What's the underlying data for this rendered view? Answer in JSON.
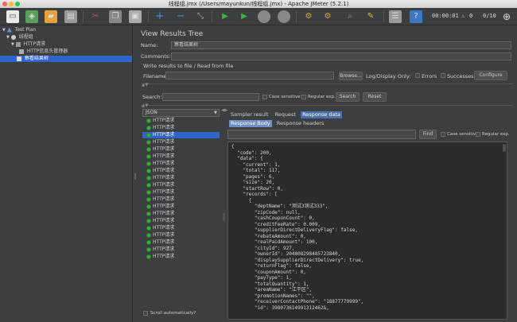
{
  "window": {
    "title": "线程组.jmx (/Users/mayunkun/线程组.jmx) - Apache JMeter (5.2.1)"
  },
  "toolbar": {
    "elapsed_time": "00:00:01",
    "warning_count": "0",
    "thread_counter": "0/10"
  },
  "tree": {
    "items": [
      {
        "label": "Test Plan"
      },
      {
        "label": "线程组"
      },
      {
        "label": "HTTP请求"
      },
      {
        "label": "HTTP信息头管理器"
      },
      {
        "label": "察看结果树"
      }
    ]
  },
  "panel": {
    "title": "View Results Tree",
    "name_label": "Name:",
    "name_value": "察看结果树",
    "comments_label": "Comments:",
    "comments_value": "",
    "write_results_label": "Write results to file / Read from file",
    "filename_label": "Filename",
    "filename_value": "",
    "browse_label": "Browse...",
    "log_display_label": "Log/Display Only:",
    "errors_label": "Errors",
    "successes_label": "Successes",
    "configure_label": "Configure",
    "search_label": "Search:",
    "search_value": "",
    "case_sensitive_label": "Case sensitive",
    "regular_exp_label": "Regular exp.",
    "search_button": "Search",
    "reset_button": "Reset",
    "renderer_value": "JSON",
    "scroll_auto_label": "Scroll automatically?"
  },
  "results": {
    "items": [
      {
        "label": "HTTP请求"
      },
      {
        "label": "HTTP请求"
      },
      {
        "label": "HTTP请求"
      },
      {
        "label": "HTTP请求"
      },
      {
        "label": "HTTP请求"
      },
      {
        "label": "HTTP请求"
      },
      {
        "label": "HTTP请求"
      },
      {
        "label": "HTTP请求"
      },
      {
        "label": "HTTP请求"
      },
      {
        "label": "HTTP请求"
      },
      {
        "label": "HTTP请求"
      },
      {
        "label": "HTTP请求"
      },
      {
        "label": "HTTP请求"
      },
      {
        "label": "HTTP请求"
      },
      {
        "label": "HTTP请求"
      },
      {
        "label": "HTTP请求"
      },
      {
        "label": "HTTP请求"
      },
      {
        "label": "HTTP请求"
      },
      {
        "label": "HTTP请求"
      },
      {
        "label": "HTTP请求"
      }
    ],
    "selected_index": 2
  },
  "detail": {
    "tabs": [
      "Sampler result",
      "Request",
      "Response data"
    ],
    "subtabs": [
      "Response Body",
      "Response headers"
    ],
    "find_button": "Find",
    "case_sensitive_label": "Case sensitive",
    "regular_exp_label": "Regular exp.",
    "find_value": "",
    "json_lines": [
      "{",
      "  \"code\": 200,",
      "  \"data\": {",
      "    \"current\": 1,",
      "    \"total\": 117,",
      "    \"pages\": 6,",
      "    \"size\": 20,",
      "    \"startRow\": 0,",
      "    \"records\": [",
      "      {",
      "        \"deptName\": \"测试3测试333\",",
      "        \"zipCode\": null,",
      "        \"cashCouponCount\": 0,",
      "        \"creditFeeRate\": 0.009,",
      "        \"supplierDirectDeliveryFlag\": false,",
      "        \"rebateAmount\": 0,",
      "        \"realPaidAmount\": 100,",
      "        \"cityId\": 927,",
      "        \"ownerId\": 204808298485723840,",
      "        \"displaySupplierDirectDelivery\": true,",
      "        \"returnFlag\": false,",
      "        \"couponAmount\": 0,",
      "        \"payType\": 1,",
      "        \"totalQuantity\": 1,",
      "        \"areaName\": \"江干区\",",
      "        \"promotionNames\": \"\",",
      "        \"receiverContactPhone\": \"18877779999\",",
      "        \"id\": 398073614991312462&,"
    ]
  }
}
